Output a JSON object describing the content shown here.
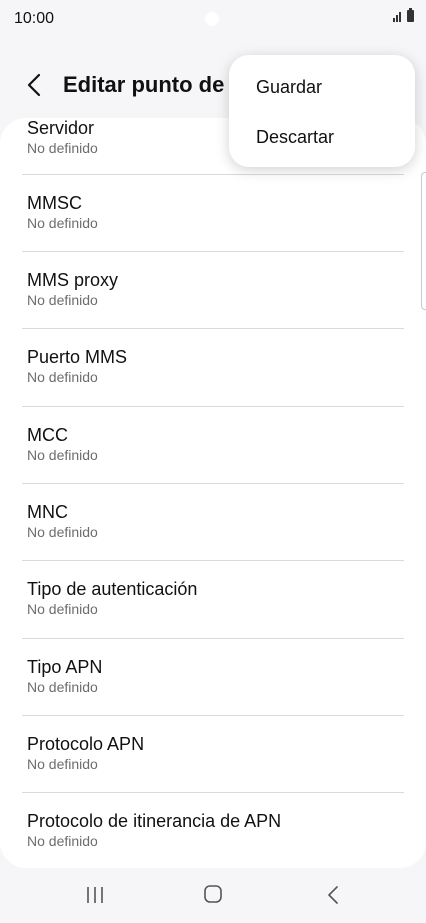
{
  "status_bar": {
    "time": "10:00"
  },
  "header": {
    "title": "Editar punto de"
  },
  "menu": {
    "items": [
      {
        "label": "Guardar"
      },
      {
        "label": "Descartar"
      }
    ]
  },
  "settings": {
    "items": [
      {
        "title": "Servidor",
        "value": "No definido"
      },
      {
        "title": "MMSC",
        "value": "No definido"
      },
      {
        "title": "MMS proxy",
        "value": "No definido"
      },
      {
        "title": "Puerto MMS",
        "value": "No definido"
      },
      {
        "title": "MCC",
        "value": "No definido"
      },
      {
        "title": "MNC",
        "value": "No definido"
      },
      {
        "title": "Tipo de autenticación",
        "value": "No definido"
      },
      {
        "title": "Tipo APN",
        "value": "No definido"
      },
      {
        "title": "Protocolo APN",
        "value": "No definido"
      },
      {
        "title": "Protocolo de itinerancia de APN",
        "value": "No definido"
      }
    ]
  },
  "icons": {
    "back": "chevron-left-icon",
    "signal": "signal-icon",
    "battery": "battery-icon",
    "nav_recent": "recent-apps-icon",
    "nav_home": "home-icon",
    "nav_back": "nav-back-icon"
  },
  "colors": {
    "background": "#f6f6f8",
    "card": "#ffffff",
    "secondary_text": "#6d6d6d"
  }
}
